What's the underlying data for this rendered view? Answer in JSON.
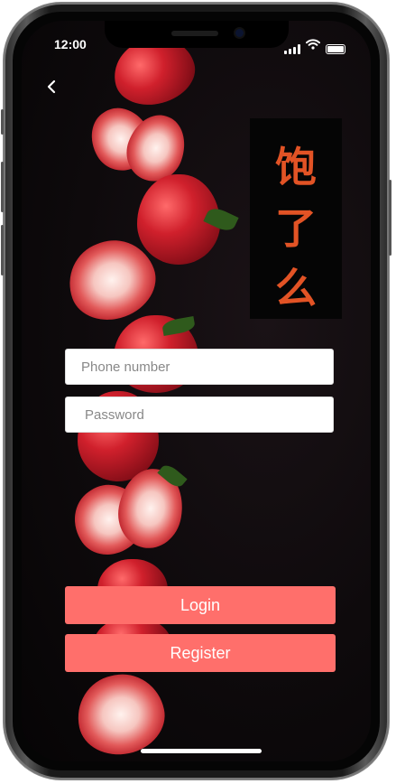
{
  "status_bar": {
    "time": "12:00",
    "icons": [
      "signal-icon",
      "wifi-icon",
      "battery-icon"
    ]
  },
  "nav": {
    "back_icon": "chevron-left-icon"
  },
  "logo": {
    "glyphs": [
      "饱",
      "了",
      "么"
    ],
    "color": "#e25325"
  },
  "form": {
    "phone_placeholder": "Phone number",
    "password_placeholder": "Password"
  },
  "actions": {
    "login_label": "Login",
    "register_label": "Register",
    "color": "#ff6f6b"
  }
}
